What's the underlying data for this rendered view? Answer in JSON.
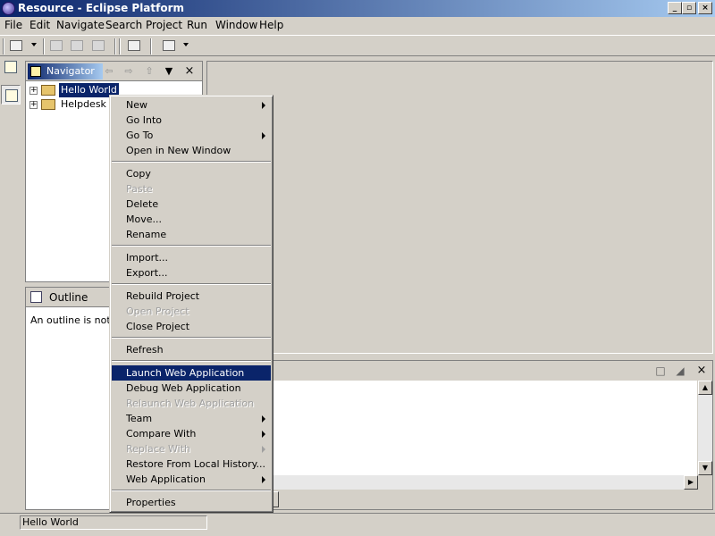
{
  "window": {
    "title": "Resource - Eclipse Platform",
    "controls": {
      "minimize": "_",
      "maximize": "▫",
      "close": "×"
    }
  },
  "menubar": [
    "File",
    "Edit",
    "Navigate",
    "Search",
    "Project",
    "Run",
    "Window",
    "Help"
  ],
  "navigator": {
    "title": "Navigator",
    "tree": [
      {
        "label": "Hello World",
        "selected": true
      },
      {
        "label": "Helpdesk",
        "selected": false
      }
    ]
  },
  "outline": {
    "title": "Outline",
    "message": "An outline is not available."
  },
  "context_menu": {
    "groups": [
      [
        {
          "label": "New",
          "submenu": true,
          "enabled": true
        },
        {
          "label": "Go Into",
          "submenu": false,
          "enabled": true
        },
        {
          "label": "Go To",
          "submenu": true,
          "enabled": true
        },
        {
          "label": "Open in New Window",
          "submenu": false,
          "enabled": true
        }
      ],
      [
        {
          "label": "Copy",
          "submenu": false,
          "enabled": true
        },
        {
          "label": "Paste",
          "submenu": false,
          "enabled": false
        },
        {
          "label": "Delete",
          "submenu": false,
          "enabled": true
        },
        {
          "label": "Move...",
          "submenu": false,
          "enabled": true
        },
        {
          "label": "Rename",
          "submenu": false,
          "enabled": true
        }
      ],
      [
        {
          "label": "Import...",
          "submenu": false,
          "enabled": true
        },
        {
          "label": "Export...",
          "submenu": false,
          "enabled": true
        }
      ],
      [
        {
          "label": "Rebuild Project",
          "submenu": false,
          "enabled": true
        },
        {
          "label": "Open Project",
          "submenu": false,
          "enabled": false
        },
        {
          "label": "Close Project",
          "submenu": false,
          "enabled": true
        }
      ],
      [
        {
          "label": "Refresh",
          "submenu": false,
          "enabled": true
        }
      ],
      [
        {
          "label": "Launch Web Application",
          "submenu": false,
          "enabled": true,
          "highlighted": true
        },
        {
          "label": "Debug Web Application",
          "submenu": false,
          "enabled": true
        },
        {
          "label": "Relaunch Web Application",
          "submenu": false,
          "enabled": false
        },
        {
          "label": "Team",
          "submenu": true,
          "enabled": true
        },
        {
          "label": "Compare With",
          "submenu": true,
          "enabled": true
        },
        {
          "label": "Replace With",
          "submenu": true,
          "enabled": false
        },
        {
          "label": "Restore From Local History...",
          "submenu": false,
          "enabled": true
        },
        {
          "label": "Web Application",
          "submenu": true,
          "enabled": true
        }
      ],
      [
        {
          "label": "Properties",
          "submenu": false,
          "enabled": true
        }
      ]
    ]
  },
  "statusbar": {
    "text": "Hello World"
  },
  "colors": {
    "face": "#d4d0c8",
    "selection": "#0a246a",
    "title_gradient_end": "#a6caf0",
    "disabled_text": "#a0a0a0"
  },
  "icons": {
    "toolbar": [
      "new-wizard-icon",
      "save-icon",
      "save-all-icon",
      "print-icon",
      "search-icon",
      "run-icon"
    ],
    "perspective": [
      "open-perspective-icon",
      "resource-perspective-icon"
    ]
  }
}
